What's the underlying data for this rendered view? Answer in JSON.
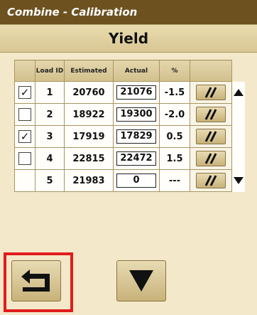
{
  "title": "Combine - Calibration",
  "header": "Yield",
  "table": {
    "headers": {
      "load_id": "Load ID",
      "estimated": "Estimated",
      "actual": "Actual",
      "percent": "%"
    },
    "rows": [
      {
        "checked": true,
        "check_mark": "✓",
        "id": "1",
        "estimated": "20760",
        "actual": "21076",
        "percent": "-1.5"
      },
      {
        "checked": false,
        "check_mark": "",
        "id": "2",
        "estimated": "18922",
        "actual": "19300",
        "percent": "-2.0"
      },
      {
        "checked": true,
        "check_mark": "✓",
        "id": "3",
        "estimated": "17919",
        "actual": "17829",
        "percent": "0.5"
      },
      {
        "checked": false,
        "check_mark": "",
        "id": "4",
        "estimated": "22815",
        "actual": "22472",
        "percent": "1.5"
      },
      {
        "checked": null,
        "check_mark": "",
        "id": "5",
        "estimated": "21983",
        "actual": "0",
        "percent": "---"
      }
    ]
  },
  "icons": {
    "edit": "edit-icon",
    "scroll_up": "arrow-up-icon",
    "scroll_down": "arrow-down-icon",
    "back": "return-arrow-icon",
    "page_down": "triangle-down-icon"
  },
  "colors": {
    "title_bar": "#6d5220",
    "background": "#f3e8c9",
    "highlight": "#e21c1c"
  }
}
